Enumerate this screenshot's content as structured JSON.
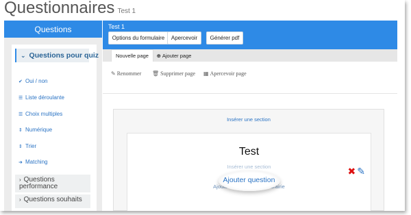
{
  "page": {
    "title": "Questionnaires",
    "subtitle": "Test 1"
  },
  "sidebar": {
    "header": "Questions",
    "group_label": "Questions pour quiz",
    "items": [
      {
        "label": "Oui / non",
        "icon": "check-icon"
      },
      {
        "label": "Liste déroulante",
        "icon": "list-icon"
      },
      {
        "label": "Choix multiples",
        "icon": "list-icon"
      },
      {
        "label": "Numérique",
        "icon": "sort-icon"
      },
      {
        "label": "Trier",
        "icon": "sort-icon"
      },
      {
        "label": "Matching",
        "icon": "arrow-right-icon"
      }
    ],
    "collapsed_groups": [
      "Questions performance",
      "Questions souhaits"
    ]
  },
  "main": {
    "form_name": "Test 1",
    "buttons": {
      "options": "Options du formulaire",
      "preview": "Apercevoir",
      "pdf": "Générer pdf"
    },
    "tabs": [
      {
        "label": "Nouvelle page",
        "active": true
      },
      {
        "label": "Ajouter page",
        "active": false
      }
    ],
    "toolbar": {
      "rename": "Renommer",
      "delete_page": "Supprimer page",
      "preview_page": "Apercevoir page"
    },
    "section": {
      "insert_section": "Insérer une section",
      "title": "Test",
      "menu_above": "Insérer une section",
      "add_question": "Ajouter question",
      "menu_below": "Ajouter question depuis librairie"
    }
  },
  "colors": {
    "accent": "#2e8ae6",
    "link": "#2a73c4",
    "delete": "#dd1111"
  }
}
